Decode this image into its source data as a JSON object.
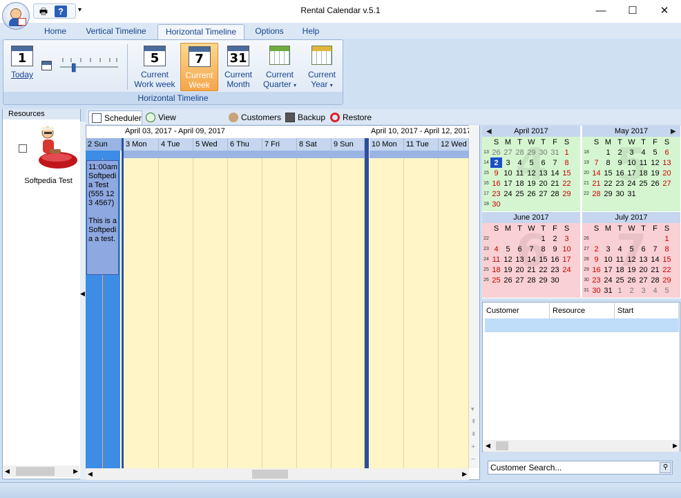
{
  "window": {
    "title": "Rental Calendar v.5.1",
    "minimize_glyph": "—",
    "maximize_glyph": "☐",
    "close_glyph": "✕"
  },
  "quick_access": {
    "print_icon": "printer-icon",
    "help_icon": "help-icon",
    "dropdown_glyph": "▾"
  },
  "ribbon_tabs": [
    "Home",
    "Vertical Timeline",
    "Horizontal Timeline",
    "Options",
    "Help"
  ],
  "active_ribbon_tab": "Horizontal Timeline",
  "ribbon": {
    "group_label": "Horizontal Timeline",
    "today": {
      "label": "Today",
      "icon_num": "1"
    },
    "current_work_week": {
      "line1": "Current",
      "line2": "Work week",
      "icon_num": "5"
    },
    "current_week": {
      "line1": "Current",
      "line2": "Week",
      "icon_num": "7"
    },
    "current_month": {
      "line1": "Current",
      "line2": "Month",
      "icon_num": "31"
    },
    "current_quarter": {
      "line1": "Current",
      "line2": "Quarter"
    },
    "current_year": {
      "line1": "Current",
      "line2": "Year"
    },
    "zoom_slider_value": 0.2
  },
  "resources": {
    "header": "Resources",
    "items": [
      {
        "name": "Softpedia Test",
        "checked": false
      }
    ]
  },
  "scheduler_tabs": [
    "Scheduler",
    "View Reservations",
    "Customers",
    "Backup",
    "Restore"
  ],
  "active_scheduler_tab": "Scheduler",
  "scheduler": {
    "week1_label": "April 03, 2017 - April 09, 2017",
    "week2_label": "April 10, 2017 - April 12, 2017",
    "days": [
      "2 Sun",
      "3 Mon",
      "4 Tue",
      "5 Wed",
      "6 Thu",
      "7 Fri",
      "8 Sat",
      "9 Sun",
      "10 Mon",
      "11 Tue",
      "12 Wed"
    ],
    "reservation": {
      "time": "11:00am",
      "resource": "Softpedia Test",
      "phone": "(555 123 4567)",
      "note": "This is a Softpedia a test."
    }
  },
  "mini_calendars": {
    "day_headers": [
      "S",
      "M",
      "T",
      "W",
      "T",
      "F",
      "S"
    ],
    "months": [
      {
        "title": "April 2017",
        "watermark": "4",
        "color": "green",
        "weeks": [
          {
            "wk": "13",
            "days": [
              "26",
              "27",
              "28",
              "29",
              "30",
              "31",
              "1"
            ]
          },
          {
            "wk": "14",
            "days": [
              "2",
              "3",
              "4",
              "5",
              "6",
              "7",
              "8"
            ]
          },
          {
            "wk": "15",
            "days": [
              "9",
              "10",
              "11",
              "12",
              "13",
              "14",
              "15"
            ]
          },
          {
            "wk": "16",
            "days": [
              "16",
              "17",
              "18",
              "19",
              "20",
              "21",
              "22"
            ]
          },
          {
            "wk": "17",
            "days": [
              "23",
              "24",
              "25",
              "26",
              "27",
              "28",
              "29"
            ]
          },
          {
            "wk": "18",
            "days": [
              "30",
              "",
              "",
              "",
              "",
              "",
              ""
            ]
          }
        ]
      },
      {
        "title": "May 2017",
        "watermark": "5",
        "color": "green",
        "weeks": [
          {
            "wk": "18",
            "days": [
              "",
              "1",
              "2",
              "3",
              "4",
              "5",
              "6"
            ]
          },
          {
            "wk": "19",
            "days": [
              "7",
              "8",
              "9",
              "10",
              "11",
              "12",
              "13"
            ]
          },
          {
            "wk": "20",
            "days": [
              "14",
              "15",
              "16",
              "17",
              "18",
              "19",
              "20"
            ]
          },
          {
            "wk": "21",
            "days": [
              "21",
              "22",
              "23",
              "24",
              "25",
              "26",
              "27"
            ]
          },
          {
            "wk": "22",
            "days": [
              "28",
              "29",
              "30",
              "31",
              "",
              "",
              ""
            ]
          },
          {
            "wk": "",
            "days": [
              "",
              "",
              "",
              "",
              "",
              "",
              ""
            ]
          }
        ]
      },
      {
        "title": "June 2017",
        "watermark": "6",
        "color": "pink",
        "weeks": [
          {
            "wk": "22",
            "days": [
              "",
              "",
              "",
              "",
              "1",
              "2",
              "3"
            ]
          },
          {
            "wk": "23",
            "days": [
              "4",
              "5",
              "6",
              "7",
              "8",
              "9",
              "10"
            ]
          },
          {
            "wk": "24",
            "days": [
              "11",
              "12",
              "13",
              "14",
              "15",
              "16",
              "17"
            ]
          },
          {
            "wk": "25",
            "days": [
              "18",
              "19",
              "20",
              "21",
              "22",
              "23",
              "24"
            ]
          },
          {
            "wk": "26",
            "days": [
              "25",
              "26",
              "27",
              "28",
              "29",
              "30",
              ""
            ]
          },
          {
            "wk": "",
            "days": [
              "",
              "",
              "",
              "",
              "",
              "",
              ""
            ]
          }
        ]
      },
      {
        "title": "July 2017",
        "watermark": "7",
        "color": "pink",
        "weeks": [
          {
            "wk": "26",
            "days": [
              "",
              "",
              "",
              "",
              "",
              "",
              "1"
            ]
          },
          {
            "wk": "27",
            "days": [
              "2",
              "3",
              "4",
              "5",
              "6",
              "7",
              "8"
            ]
          },
          {
            "wk": "28",
            "days": [
              "9",
              "10",
              "11",
              "12",
              "13",
              "14",
              "15"
            ]
          },
          {
            "wk": "29",
            "days": [
              "16",
              "17",
              "18",
              "19",
              "20",
              "21",
              "22"
            ]
          },
          {
            "wk": "30",
            "days": [
              "23",
              "24",
              "25",
              "26",
              "27",
              "28",
              "29"
            ]
          },
          {
            "wk": "31",
            "days": [
              "30",
              "31",
              "1",
              "2",
              "3",
              "4",
              "5"
            ]
          }
        ]
      }
    ],
    "selected_day": "2",
    "prev_glyph": "◀",
    "next_glyph": "▶"
  },
  "customer_grid": {
    "columns": [
      "Customer",
      "Resource",
      "Start"
    ],
    "search_placeholder": "Customer Search..."
  },
  "colors": {
    "accent": "#15428b",
    "active_button": "#f6a54a",
    "sunday_column": "#3d8ce6",
    "day_cells": "#fff5c6",
    "weekend_red": "#cc0000"
  }
}
